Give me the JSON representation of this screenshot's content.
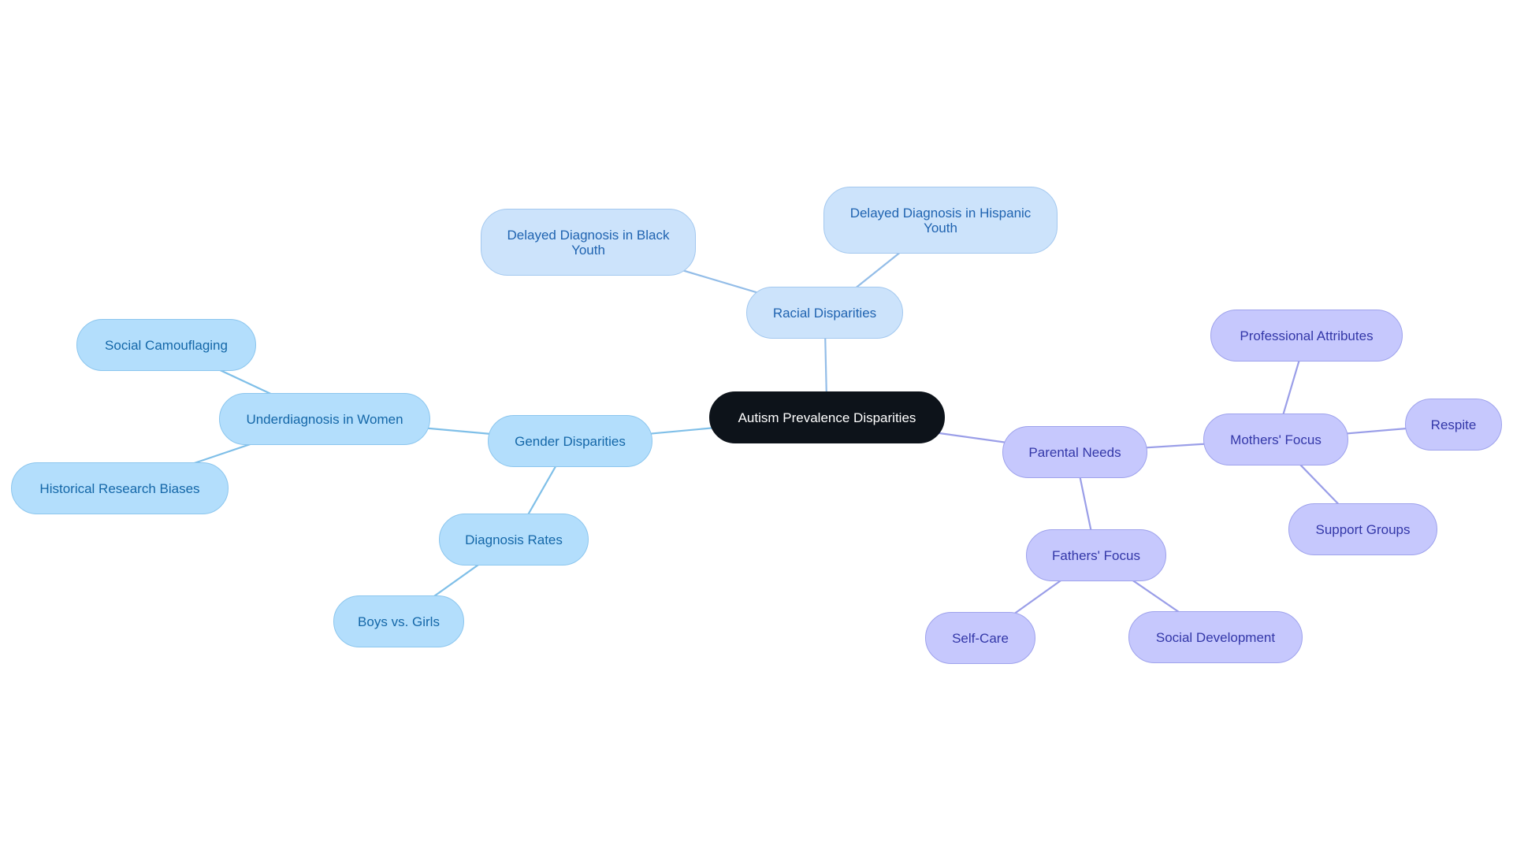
{
  "diagram": {
    "type": "mindmap",
    "title": "Autism Prevalence Disparities",
    "colors": {
      "root_fill": "#0d131a",
      "root_text": "#ffffff",
      "racial_fill": "#cce3fb",
      "racial_text": "#1f63b0",
      "racial_edge": "#93bde8",
      "gender_fill": "#b3defc",
      "gender_text": "#1467a8",
      "gender_edge": "#7fbfe8",
      "parental_fill": "#c6c8fd",
      "parental_text": "#3337a8",
      "parental_edge": "#9a9ee8"
    },
    "nodes": [
      {
        "id": "root",
        "label": "Autism Prevalence Disparities",
        "branch": "root"
      },
      {
        "id": "racial",
        "label": "Racial Disparities",
        "branch": "racial",
        "parent": "root"
      },
      {
        "id": "black",
        "label": "Delayed Diagnosis in Black Youth",
        "branch": "racial",
        "parent": "racial"
      },
      {
        "id": "hispanic",
        "label": "Delayed Diagnosis in Hispanic Youth",
        "branch": "racial",
        "parent": "racial"
      },
      {
        "id": "gender",
        "label": "Gender Disparities",
        "branch": "gender",
        "parent": "root"
      },
      {
        "id": "women",
        "label": "Underdiagnosis in Women",
        "branch": "gender",
        "parent": "gender"
      },
      {
        "id": "camo",
        "label": "Social Camouflaging",
        "branch": "gender",
        "parent": "women"
      },
      {
        "id": "hist",
        "label": "Historical Research Biases",
        "branch": "gender",
        "parent": "women"
      },
      {
        "id": "rates",
        "label": "Diagnosis Rates",
        "branch": "gender",
        "parent": "gender"
      },
      {
        "id": "boys",
        "label": "Boys vs. Girls",
        "branch": "gender",
        "parent": "rates"
      },
      {
        "id": "parental",
        "label": "Parental Needs",
        "branch": "parent",
        "parent": "root"
      },
      {
        "id": "mothers",
        "label": "Mothers' Focus",
        "branch": "parent",
        "parent": "parental"
      },
      {
        "id": "prof",
        "label": "Professional Attributes",
        "branch": "parent",
        "parent": "mothers"
      },
      {
        "id": "respite",
        "label": "Respite",
        "branch": "parent",
        "parent": "mothers"
      },
      {
        "id": "support",
        "label": "Support Groups",
        "branch": "parent",
        "parent": "mothers"
      },
      {
        "id": "fathers",
        "label": "Fathers' Focus",
        "branch": "parent",
        "parent": "parental"
      },
      {
        "id": "selfcare",
        "label": "Self-Care",
        "branch": "parent",
        "parent": "fathers"
      },
      {
        "id": "social",
        "label": "Social Development",
        "branch": "parent",
        "parent": "fathers"
      }
    ]
  }
}
